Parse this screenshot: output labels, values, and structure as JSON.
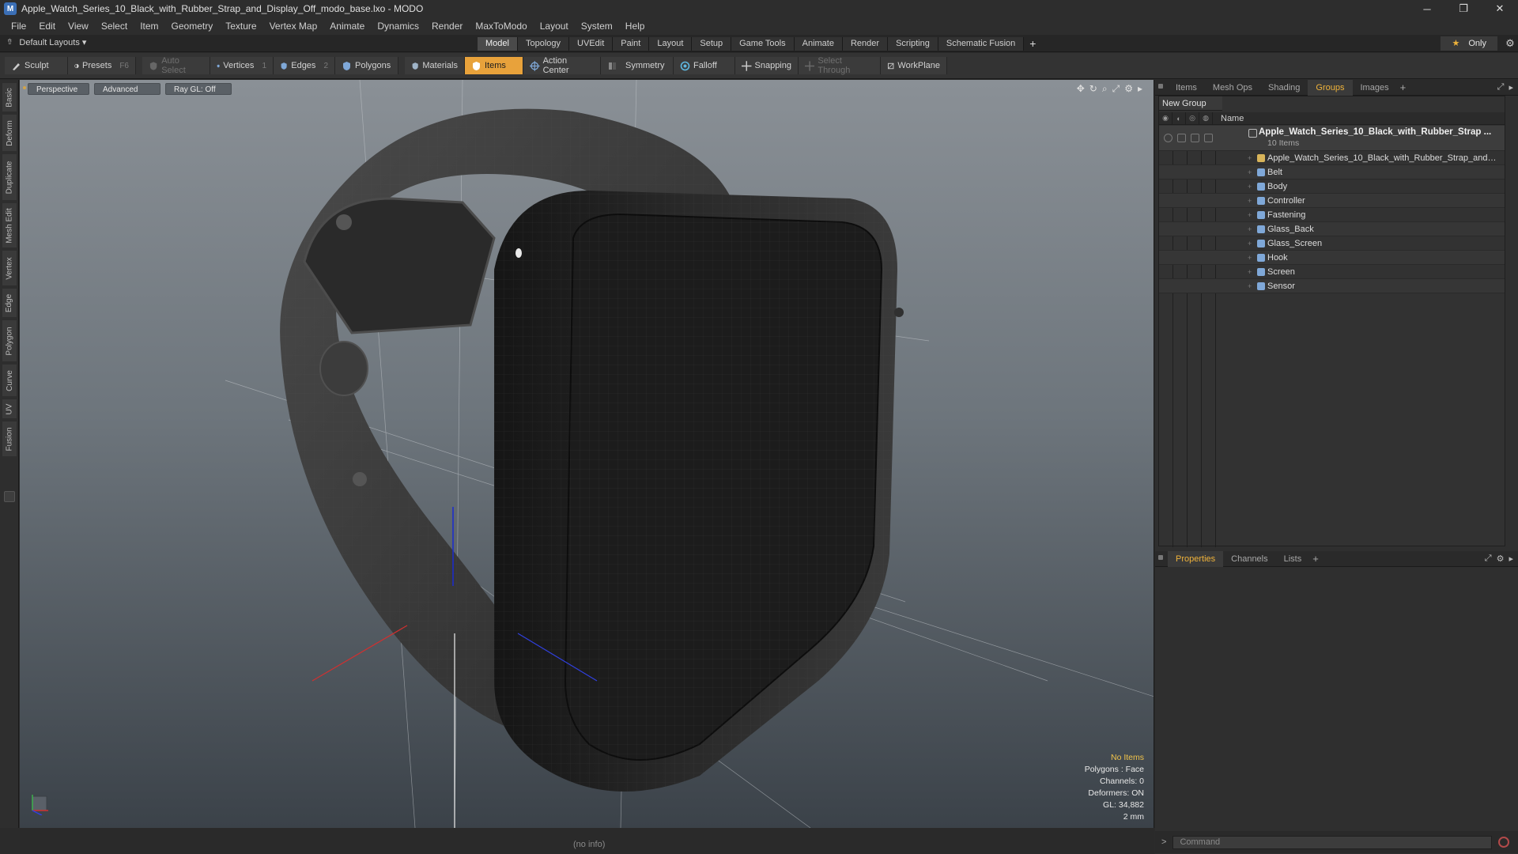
{
  "window": {
    "title": "Apple_Watch_Series_10_Black_with_Rubber_Strap_and_Display_Off_modo_base.lxo - MODO",
    "app_icon": "modo-icon",
    "minimize_glyph": "─",
    "maximize_glyph": "❐",
    "close_glyph": "✕"
  },
  "menubar": {
    "items": [
      "File",
      "Edit",
      "View",
      "Select",
      "Item",
      "Geometry",
      "Texture",
      "Vertex Map",
      "Animate",
      "Dynamics",
      "Render",
      "MaxToModo",
      "Layout",
      "System",
      "Help"
    ]
  },
  "tabbar": {
    "layouts_label": "Default Layouts ▾",
    "tabs": [
      "Model",
      "Topology",
      "UVEdit",
      "Paint",
      "Layout",
      "Setup",
      "Game Tools",
      "Animate",
      "Render",
      "Scripting",
      "Schematic Fusion"
    ],
    "active_tab": "Model",
    "add_glyph": "+",
    "only_label": "Only",
    "star_glyph": "★",
    "gear_glyph": "⚙"
  },
  "toolbar": {
    "sculpt": "Sculpt",
    "presets": "Presets",
    "presets_key": "F6",
    "auto_select": "Auto Select",
    "vertices": "Vertices",
    "vertices_key": "1",
    "edges": "Edges",
    "edges_key": "2",
    "polygons": "Polygons",
    "materials": "Materials",
    "items": "Items",
    "action_center": "Action Center",
    "symmetry": "Symmetry",
    "falloff": "Falloff",
    "snapping": "Snapping",
    "select_through": "Select Through",
    "workplane": "WorkPlane",
    "accent_color": "#e8a23b"
  },
  "left_tabs": [
    "Basic",
    "Deform",
    "Duplicate",
    "Mesh Edit",
    "Vertex",
    "Edge",
    "Polygon",
    "Curve",
    "UV",
    "Fusion"
  ],
  "viewport": {
    "perspective": "Perspective",
    "advanced": "Advanced",
    "raygl": "Ray GL: Off",
    "tools": [
      "✥",
      "↻",
      "⌕",
      "⤢",
      "⚙",
      "▸"
    ],
    "stats": {
      "no_items": "No Items",
      "polygons": "Polygons : Face",
      "channels": "Channels: 0",
      "deformers": "Deformers: ON",
      "gl": "GL: 34,882",
      "size": "2 mm"
    },
    "info": "(no info)"
  },
  "right_panel": {
    "top_tabs": [
      "Items",
      "Mesh Ops",
      "Shading",
      "Groups",
      "Images"
    ],
    "active_top_tab": "Groups",
    "add_glyph": "+",
    "new_group": "New Group",
    "name_header": "Name",
    "group_name": "Apple_Watch_Series_10_Black_with_Rubber_Strap ...",
    "group_count": "10 Items",
    "items": [
      "Apple_Watch_Series_10_Black_with_Rubber_Strap_and_D...",
      "Belt",
      "Body",
      "Controller",
      "Fastening",
      "Glass_Back",
      "Glass_Screen",
      "Hook",
      "Screen",
      "Sensor"
    ],
    "bottom_tabs": [
      "Properties",
      "Channels",
      "Lists"
    ],
    "active_bottom_tab": "Properties",
    "command_prompt": ">",
    "command_placeholder": "Command"
  }
}
